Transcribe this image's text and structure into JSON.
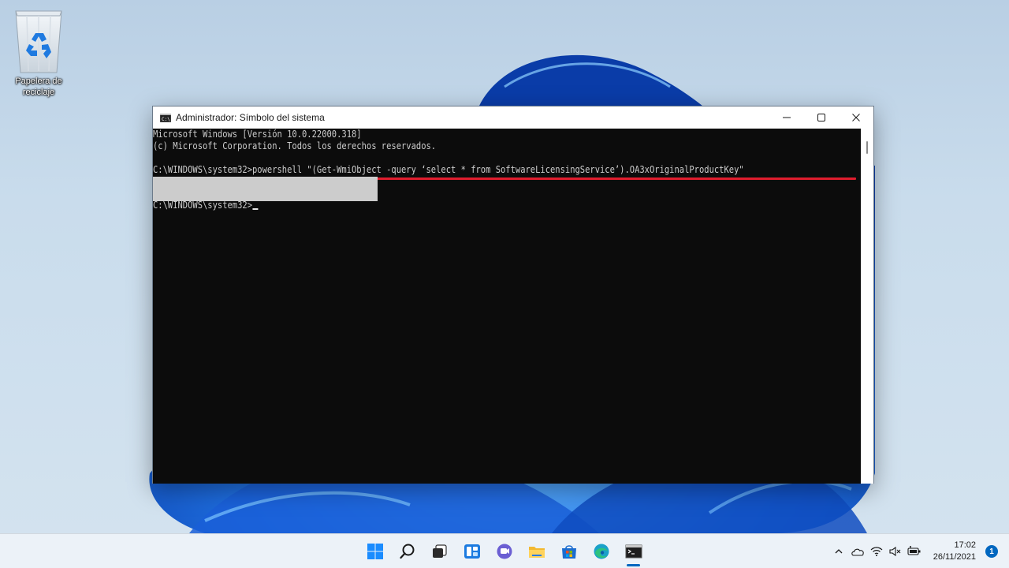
{
  "desktop": {
    "icons": [
      {
        "label": "Papelera de reciclaje",
        "icon": "recycle-bin-icon"
      }
    ]
  },
  "window": {
    "title": "Administrador: Símbolo del sistema",
    "app_icon": "cmd-icon",
    "controls": [
      "minimize-icon",
      "maximize-icon",
      "close-icon"
    ]
  },
  "console": {
    "lines": [
      "Microsoft Windows [Versión 10.0.22000.318]",
      "(c) Microsoft Corporation. Todos los derechos reservados.",
      "C:\\WINDOWS\\system32>powershell \"(Get-WmiObject -query ‘select * from SoftwareLicensingService’).OA3xOriginalProductKey\"",
      "C:\\WINDOWS\\system32>"
    ],
    "highlight_color": "#e11d2e",
    "text_color": "#cccccc",
    "background": "#0c0c0c"
  },
  "taskbar": {
    "items": [
      "windows-start-icon",
      "search-icon",
      "task-view-icon",
      "widgets-icon",
      "teams-chat-icon",
      "file-explorer-icon",
      "microsoft-store-icon",
      "edge-icon",
      "command-prompt-icon"
    ],
    "active_item": "command-prompt-icon",
    "tray": [
      "chevron-up-icon",
      "onedrive-icon",
      "wifi-icon",
      "volume-muted-icon",
      "battery-plug-icon"
    ],
    "time": "17:02",
    "date": "26/11/2021",
    "notification_count": "1",
    "accent": "#0067c0"
  }
}
